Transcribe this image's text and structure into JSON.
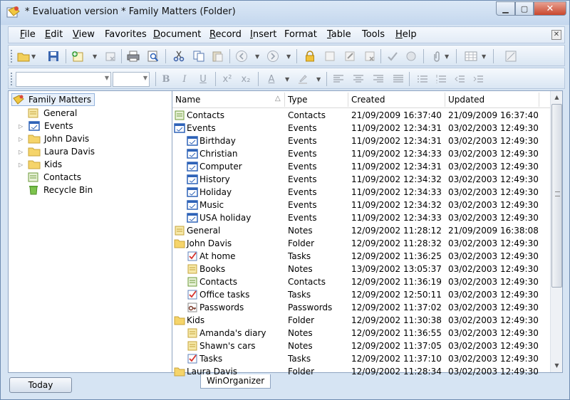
{
  "window": {
    "title": "* Evaluation version * Family Matters (Folder)"
  },
  "menu": [
    {
      "label": "File",
      "ul": "F",
      "rest": "ile"
    },
    {
      "label": "Edit",
      "ul": "E",
      "rest": "dit"
    },
    {
      "label": "View",
      "ul": "V",
      "rest": "iew"
    },
    {
      "label": "Favorites",
      "ul": "",
      "rest": "Favorites"
    },
    {
      "label": "Document",
      "ul": "D",
      "rest": "ocument"
    },
    {
      "label": "Record",
      "ul": "R",
      "rest": "ecord"
    },
    {
      "label": "Insert",
      "ul": "I",
      "rest": "nsert"
    },
    {
      "label": "Format",
      "ul": "",
      "rest": "Format"
    },
    {
      "label": "Table",
      "ul": "T",
      "rest": "able"
    },
    {
      "label": "Tools",
      "ul": "",
      "rest": "Tools"
    },
    {
      "label": "Help",
      "ul": "H",
      "rest": "elp"
    }
  ],
  "tree": {
    "root": "Family Matters",
    "items": [
      "General",
      "Events",
      "John Davis",
      "Laura Davis",
      "Kids",
      "Contacts",
      "Recycle Bin"
    ]
  },
  "list": {
    "headers": {
      "name": "Name",
      "type": "Type",
      "created": "Created",
      "updated": "Updated"
    },
    "rows": [
      {
        "name": "Contacts",
        "type": "Contacts",
        "created": "21/09/2009 16:37:40",
        "updated": "21/09/2009 16:37:40",
        "icon": "contacts-icon"
      },
      {
        "name": "Events",
        "type": "Events",
        "created": "11/09/2002 12:34:31",
        "updated": "03/02/2003 12:49:30",
        "icon": "events-icon"
      },
      {
        "name": "Birthday",
        "type": "Events",
        "created": "11/09/2002 12:34:31",
        "updated": "03/02/2003 12:49:30",
        "icon": "events-icon"
      },
      {
        "name": "Christian",
        "type": "Events",
        "created": "11/09/2002 12:34:33",
        "updated": "03/02/2003 12:49:30",
        "icon": "events-icon"
      },
      {
        "name": "Computer",
        "type": "Events",
        "created": "11/09/2002 12:34:31",
        "updated": "03/02/2003 12:49:30",
        "icon": "events-icon"
      },
      {
        "name": "History",
        "type": "Events",
        "created": "11/09/2002 12:34:32",
        "updated": "03/02/2003 12:49:30",
        "icon": "events-icon"
      },
      {
        "name": "Holiday",
        "type": "Events",
        "created": "11/09/2002 12:34:33",
        "updated": "03/02/2003 12:49:30",
        "icon": "events-icon"
      },
      {
        "name": "Music",
        "type": "Events",
        "created": "11/09/2002 12:34:32",
        "updated": "03/02/2003 12:49:30",
        "icon": "events-icon"
      },
      {
        "name": "USA holiday",
        "type": "Events",
        "created": "11/09/2002 12:34:33",
        "updated": "03/02/2003 12:49:30",
        "icon": "events-icon"
      },
      {
        "name": "General",
        "type": "Notes",
        "created": "12/09/2002 11:28:12",
        "updated": "21/09/2009 16:38:08",
        "icon": "notes-icon"
      },
      {
        "name": "John Davis",
        "type": "Folder",
        "created": "12/09/2002 11:28:32",
        "updated": "03/02/2003 12:49:30",
        "icon": "folder-icon"
      },
      {
        "name": "At home",
        "type": "Tasks",
        "created": "12/09/2002 11:36:25",
        "updated": "03/02/2003 12:49:30",
        "icon": "tasks-icon"
      },
      {
        "name": "Books",
        "type": "Notes",
        "created": "13/09/2002 13:05:37",
        "updated": "03/02/2003 12:49:30",
        "icon": "notes-icon"
      },
      {
        "name": "Contacts",
        "type": "Contacts",
        "created": "12/09/2002 11:36:19",
        "updated": "03/02/2003 12:49:30",
        "icon": "contacts-icon"
      },
      {
        "name": "Office tasks",
        "type": "Tasks",
        "created": "12/09/2002 12:50:11",
        "updated": "03/02/2003 12:49:30",
        "icon": "tasks-icon"
      },
      {
        "name": "Passwords",
        "type": "Passwords",
        "created": "12/09/2002 11:37:02",
        "updated": "03/02/2003 12:49:30",
        "icon": "passwords-icon"
      },
      {
        "name": "Kids",
        "type": "Folder",
        "created": "12/09/2002 11:30:38",
        "updated": "03/02/2003 12:49:30",
        "icon": "folder-icon"
      },
      {
        "name": "Amanda's diary",
        "type": "Notes",
        "created": "12/09/2002 11:36:55",
        "updated": "03/02/2003 12:49:30",
        "icon": "notes-icon"
      },
      {
        "name": "Shawn's cars",
        "type": "Notes",
        "created": "12/09/2002 11:37:05",
        "updated": "03/02/2003 12:49:30",
        "icon": "notes-icon"
      },
      {
        "name": "Tasks",
        "type": "Tasks",
        "created": "12/09/2002 11:37:10",
        "updated": "03/02/2003 12:49:30",
        "icon": "tasks-icon"
      },
      {
        "name": "Laura Davis",
        "type": "Folder",
        "created": "12/09/2002 11:28:34",
        "updated": "03/02/2003 12:49:30",
        "icon": "folder-icon"
      }
    ]
  },
  "status": {
    "today": "Today",
    "tab": "WinOrganizer"
  },
  "colors": {
    "folder": "#f5d46a",
    "events": "#2f63b8",
    "notes": "#f1e3a2",
    "contacts": "#8dbb57",
    "tasks": "#d6312b"
  }
}
